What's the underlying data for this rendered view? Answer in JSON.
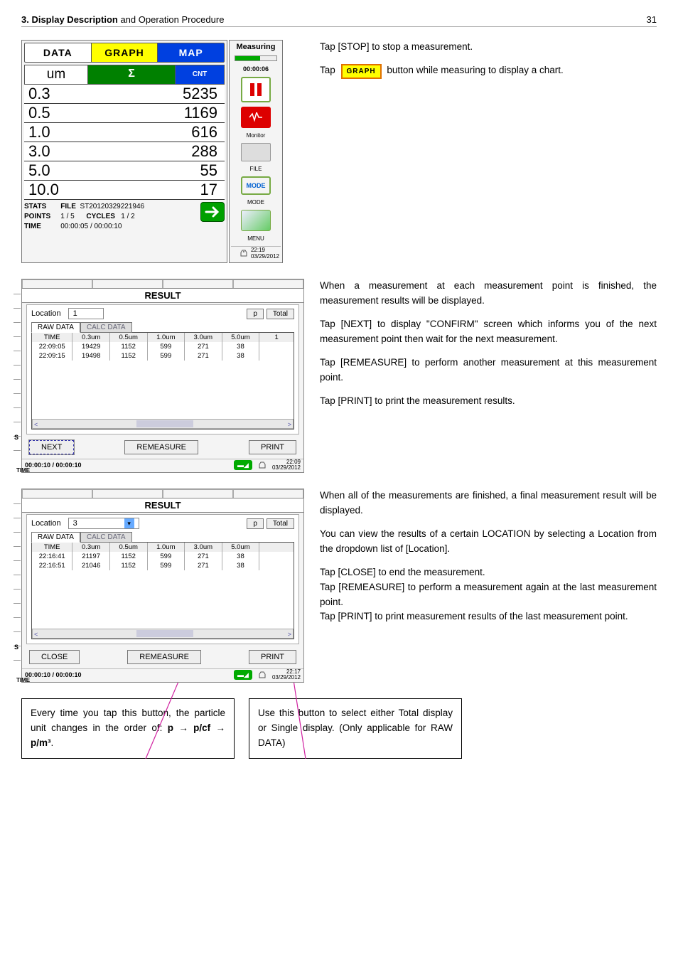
{
  "header": {
    "chapter_bold": "3. Display Description",
    "chapter_rest": " and Operation Procedure",
    "page_no": "31"
  },
  "shot1": {
    "tabs": {
      "data": "DATA",
      "graph": "GRAPH",
      "map": "MAP"
    },
    "subtabs": {
      "um": "um",
      "sigma": "Σ",
      "cnt": "CNT"
    },
    "rows": [
      {
        "size": "0.3",
        "count": "5235"
      },
      {
        "size": "0.5",
        "count": "1169"
      },
      {
        "size": "1.0",
        "count": "616"
      },
      {
        "size": "3.0",
        "count": "288"
      },
      {
        "size": "5.0",
        "count": "55"
      },
      {
        "size": "10.0",
        "count": "17"
      }
    ],
    "footer": {
      "stats": "STATS",
      "file_lbl": "FILE",
      "file_val": "ST20120329221946",
      "points": "POINTS",
      "points_val": "1 / 5",
      "cycles": "CYCLES",
      "cycles_val": "1 / 2",
      "time": "TIME",
      "time_val": "00:00:05 / 00:00:10"
    },
    "side": {
      "measuring": "Measuring",
      "timer": "00:00:06",
      "monitor": "Monitor",
      "file": "FILE",
      "mode": "MODE",
      "menu": "MENU",
      "clock_time": "22:19",
      "clock_date": "03/29/2012"
    }
  },
  "text1": {
    "p1": "Tap [STOP] to stop a measurement.",
    "p2a": "Tap ",
    "graph_chip": "GRAPH",
    "p2b": " button while measuring to display a chart."
  },
  "shot2": {
    "title": "RESULT",
    "location_lbl": "Location",
    "location_val": "1",
    "btn_p": "p",
    "btn_total": "Total",
    "tab_raw": "RAW DATA",
    "tab_calc": "CALC DATA",
    "headers": [
      "TIME",
      "0.3um",
      "0.5um",
      "1.0um",
      "3.0um",
      "5.0um",
      "1"
    ],
    "rows": [
      [
        "22:09:05",
        "19429",
        "1152",
        "599",
        "271",
        "38",
        ""
      ],
      [
        "22:09:15",
        "19498",
        "1152",
        "599",
        "271",
        "38",
        ""
      ]
    ],
    "actions": {
      "next": "NEXT",
      "remeasure": "REMEASURE",
      "print": "PRINT"
    },
    "foot_time": "00:00:10 / 00:00:10",
    "clock_time": "22:09",
    "clock_date": "03/29/2012"
  },
  "text2": {
    "p1": "When a measurement at each measurement point is finished, the measurement results will be displayed.",
    "p2": "Tap [NEXT] to display \"CONFIRM\" screen which informs you of the next measurement point then wait for the next measurement.",
    "p3": "Tap [REMEASURE] to perform another measurement at this measurement point.",
    "p4": "Tap [PRINT] to print the measurement results."
  },
  "shot3": {
    "title": "RESULT",
    "location_lbl": "Location",
    "location_val": "3",
    "btn_p": "p",
    "btn_total": "Total",
    "tab_raw": "RAW DATA",
    "tab_calc": "CALC DATA",
    "headers": [
      "TIME",
      "0.3um",
      "0.5um",
      "1.0um",
      "3.0um",
      "5.0um",
      ""
    ],
    "rows": [
      [
        "22:16:41",
        "21197",
        "1152",
        "599",
        "271",
        "38",
        ""
      ],
      [
        "22:16:51",
        "21046",
        "1152",
        "599",
        "271",
        "38",
        ""
      ]
    ],
    "actions": {
      "close": "CLOSE",
      "remeasure": "REMEASURE",
      "print": "PRINT"
    },
    "foot_time": "00:00:10 / 00:00:10",
    "clock_time": "22:17",
    "clock_date": "03/29/2012"
  },
  "text3": {
    "p1": "When all of the measurements are finished, a final measurement result will be displayed.",
    "p2": "You can view the results of a certain LOCATION by selecting a Location from the dropdown list of [Location].",
    "p3": "Tap [CLOSE] to end the measurement.",
    "p4": "Tap [REMEASURE] to perform a measurement again at the last measurement point.",
    "p5": "Tap [PRINT] to print measurement results of the last measurement point."
  },
  "callouts": {
    "c1a": "Every time you tap this button, the particle unit changes in the order of:",
    "c1b": "p → p/cf → p/m³",
    "c1c": ".",
    "c2": "Use this button to select either Total display or Single display. (Only applicable for RAW DATA)"
  },
  "marks": {
    "s": "S",
    "time": "TIME"
  }
}
